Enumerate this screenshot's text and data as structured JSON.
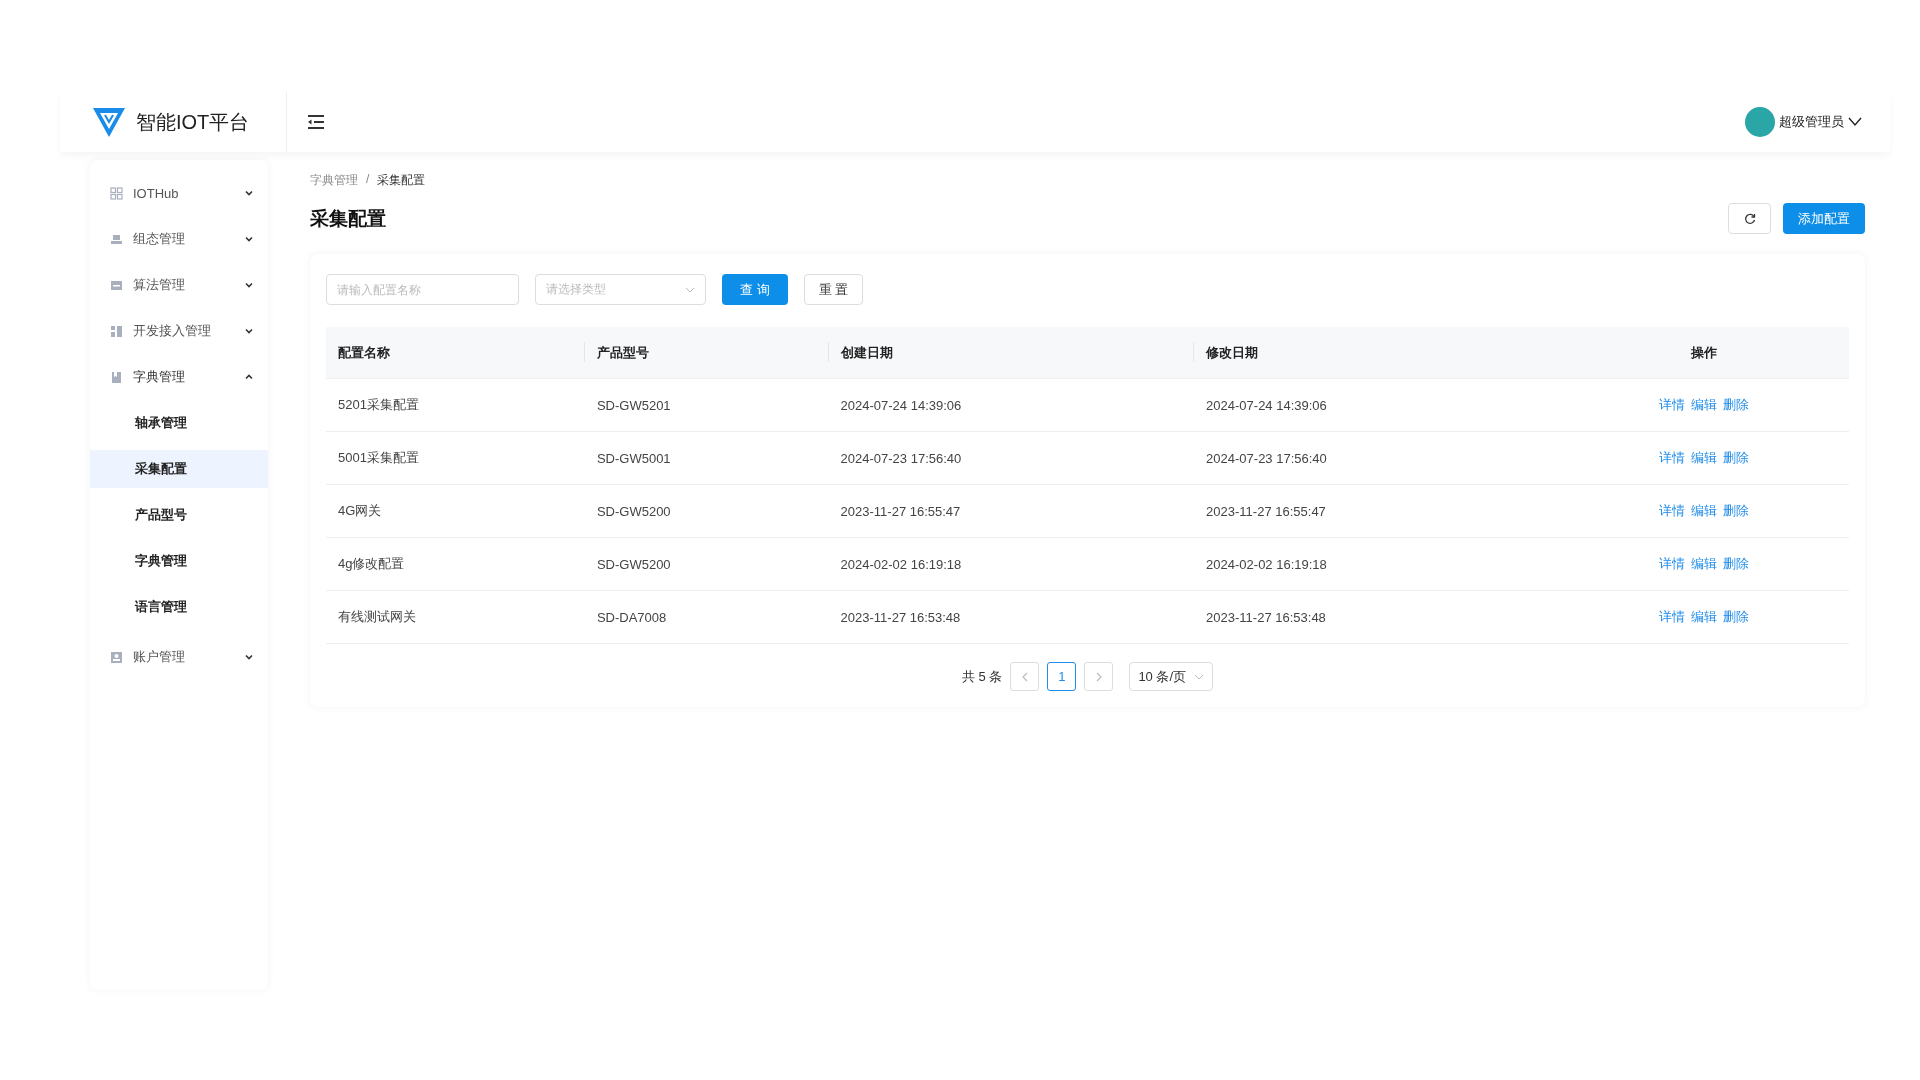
{
  "header": {
    "app_name": "智能IOT平台",
    "user": "超级管理员"
  },
  "sidebar": {
    "items": [
      {
        "label": "IOTHub",
        "expanded": false
      },
      {
        "label": "组态管理",
        "expanded": false
      },
      {
        "label": "算法管理",
        "expanded": false
      },
      {
        "label": "开发接入管理",
        "expanded": false
      },
      {
        "label": "字典管理",
        "expanded": true,
        "children": [
          {
            "label": "轴承管理",
            "selected": false
          },
          {
            "label": "采集配置",
            "selected": true
          },
          {
            "label": "产品型号",
            "selected": false
          },
          {
            "label": "字典管理",
            "selected": false
          },
          {
            "label": "语言管理",
            "selected": false
          }
        ]
      },
      {
        "label": "账户管理",
        "expanded": false
      }
    ]
  },
  "breadcrumb": [
    "字典管理",
    "采集配置"
  ],
  "breadcrumb_separator": "/",
  "page_title": "采集配置",
  "add_button": "添加配置",
  "filters": {
    "name": {
      "placeholder": "请输入配置名称"
    },
    "type": {
      "placeholder": "请选择类型"
    },
    "query_button": "查 询",
    "reset_button": "重 置"
  },
  "table": {
    "columns": [
      "配置名称",
      "产品型号",
      "创建日期",
      "修改日期",
      "操作"
    ],
    "rows": [
      {
        "name": "5201采集配置",
        "product": "SD-GW5201",
        "created": "2024-07-24 14:39:06",
        "modified": "2024-07-24 14:39:06",
        "actions": [
          "详情",
          "编辑",
          "删除"
        ]
      },
      {
        "name": "5001采集配置",
        "product": "SD-GW5001",
        "created": "2024-07-23 17:56:40",
        "modified": "2024-07-23 17:56:40",
        "actions": [
          "详情",
          "编辑",
          "删除"
        ]
      },
      {
        "name": "4G网关",
        "product": "SD-GW5200",
        "created": "2023-11-27 16:55:47",
        "modified": "2023-11-27 16:55:47",
        "actions": [
          "详情",
          "编辑",
          "删除"
        ]
      },
      {
        "name": "4g修改配置",
        "product": "SD-GW5200",
        "created": "2024-02-02 16:19:18",
        "modified": "2024-02-02 16:19:18",
        "actions": [
          "详情",
          "编辑",
          "删除"
        ]
      },
      {
        "name": "有线测试网关",
        "product": "SD-DA7008",
        "created": "2023-11-27 16:53:48",
        "modified": "2023-11-27 16:53:48",
        "actions": [
          "详情",
          "编辑",
          "删除"
        ]
      }
    ]
  },
  "pagination": {
    "total": "共 5 条",
    "pages": [
      {
        "label": "1",
        "selected": true
      }
    ],
    "page_size": "10 条/页"
  }
}
